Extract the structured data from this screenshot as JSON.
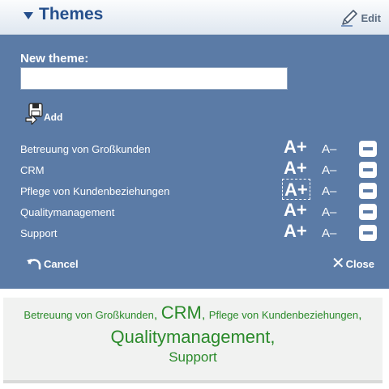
{
  "header": {
    "title": "Themes",
    "edit_label": "Edit"
  },
  "form": {
    "new_theme_label": "New theme:",
    "input_value": "",
    "input_placeholder": "",
    "add_label": "Add"
  },
  "themes": [
    {
      "name": "Betreuung von Großkunden",
      "increase_label": "A+",
      "decrease_label": "A–"
    },
    {
      "name": "CRM",
      "increase_label": "A+",
      "decrease_label": "A–"
    },
    {
      "name": "Pflege von Kundenbeziehungen",
      "increase_label": "A+",
      "decrease_label": "A–"
    },
    {
      "name": "Qualitymanagement",
      "increase_label": "A+",
      "decrease_label": "A–"
    },
    {
      "name": "Support",
      "increase_label": "A+",
      "decrease_label": "A–"
    }
  ],
  "footer": {
    "cancel_label": "Cancel",
    "close_label": "Close",
    "close_symbol": "✕"
  },
  "cloud": {
    "words": [
      "Betreuung von Großkunden",
      "CRM",
      "Pflege von Kundenbeziehungen",
      "Qualitymanagement",
      "Support"
    ],
    "separator": ","
  },
  "colors": {
    "title": "#254f8c",
    "panel": "#5b7ba6",
    "cloud_text": "#2a8a2a",
    "cloud_bg": "#f1f2f1"
  },
  "icons": {
    "collapse": "triangle-down-icon",
    "edit": "pencil-icon",
    "add": "save-add-icon",
    "cancel": "undo-arrow-icon",
    "close": "x-icon",
    "remove": "minus-box-icon"
  }
}
